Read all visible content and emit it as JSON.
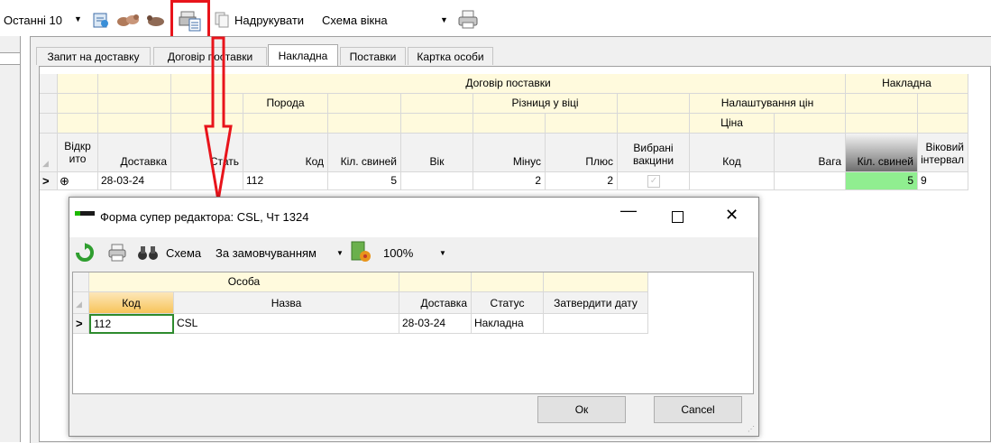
{
  "toolbar": {
    "recent_label": "Останні 10",
    "print_label": "Надрукувати",
    "scheme_value": "Схема вікна"
  },
  "tabs": [
    {
      "label": "Запит на доставку"
    },
    {
      "label": "Договір поставки"
    },
    {
      "label": "Накладна",
      "active": true
    },
    {
      "label": "Поставки"
    },
    {
      "label": "Картка особи"
    }
  ],
  "grid": {
    "bands": {
      "contract": "Договір поставки",
      "invoice": "Накладна",
      "breed": "Порода",
      "age_diff": "Різниця у віці",
      "price_settings": "Налаштування цін",
      "price": "Ціна"
    },
    "headers": {
      "open": "Відкр\nито",
      "delivery": "Доставка",
      "status": "Стать",
      "code": "Код",
      "pig_count": "Кіл. свиней",
      "age": "Вік",
      "minus": "Мінус",
      "plus": "Плюс",
      "vaccines": "Вибрані\nвакцини",
      "price_code": "Код",
      "weight": "Вага",
      "inv_pig_count": "Кіл. свиней",
      "age_interval": "Віковий\nінтервал"
    },
    "row": {
      "expand": "⊕",
      "delivery": "28-03-24",
      "code": "112",
      "pig_count": "5",
      "minus": "2",
      "plus": "2",
      "inv_pig_count": "5",
      "age_interval": "9"
    }
  },
  "dialog": {
    "title": "Форма супер редактора: CSL, Чт 1324",
    "scheme_label": "Схема",
    "scheme_value": "За замовчуванням",
    "zoom": "100%",
    "band_person": "Особа",
    "headers": {
      "code": "Код",
      "name": "Назва",
      "delivery": "Доставка",
      "status": "Статус",
      "approve": "Затвердити дату"
    },
    "row": {
      "code": "112",
      "name": "CSL",
      "delivery": "28-03-24",
      "status": "Накладна"
    },
    "ok_label": "Ок",
    "cancel_label": "Cancel"
  },
  "colors": {
    "band": "#fffadd",
    "highlight_green": "#90ee90",
    "annotation_red": "#e8141b",
    "active_header_dark": "#6e6e6e"
  }
}
